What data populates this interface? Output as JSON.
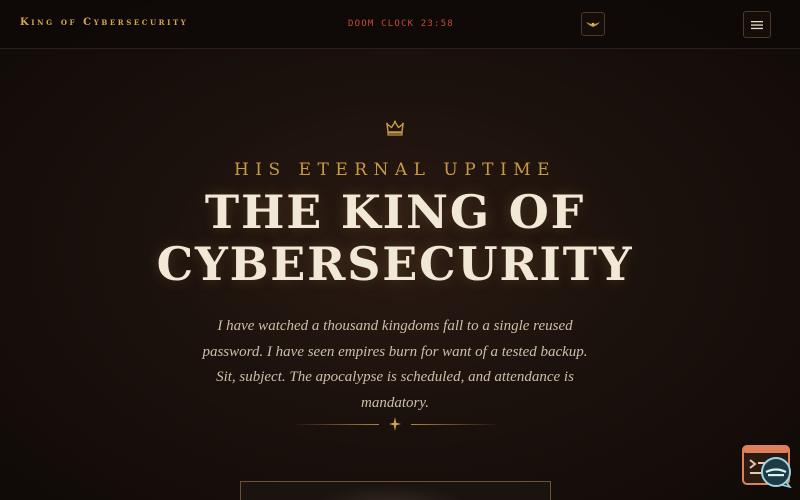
{
  "navbar": {
    "brand": "King of Cybersecurity",
    "doom_clock": "DOOM CLOCK 23:58"
  },
  "hero": {
    "eyebrow": "HIS ETERNAL UPTIME",
    "title_line1": "THE KING OF",
    "title_line2": "CYBERSECURITY",
    "intro": "I have watched a thousand kingdoms fall to a single reused password. I have seen empires burn for want of a tested backup. Sit, subject. The apocalypse is scheduled, and attendance is mandatory."
  },
  "icons": {
    "crown": "crown-icon",
    "emblem": "winged-emblem-icon",
    "menu": "hamburger-menu-icon",
    "divider": "four-point-star-icon",
    "terminal": "terminal-widget-icon",
    "help": "chat-help-icon"
  },
  "colors": {
    "gold": "#c99a45",
    "doom_red": "#c44b3a",
    "title_cream": "#f2e8d6",
    "background": "#120c09"
  }
}
